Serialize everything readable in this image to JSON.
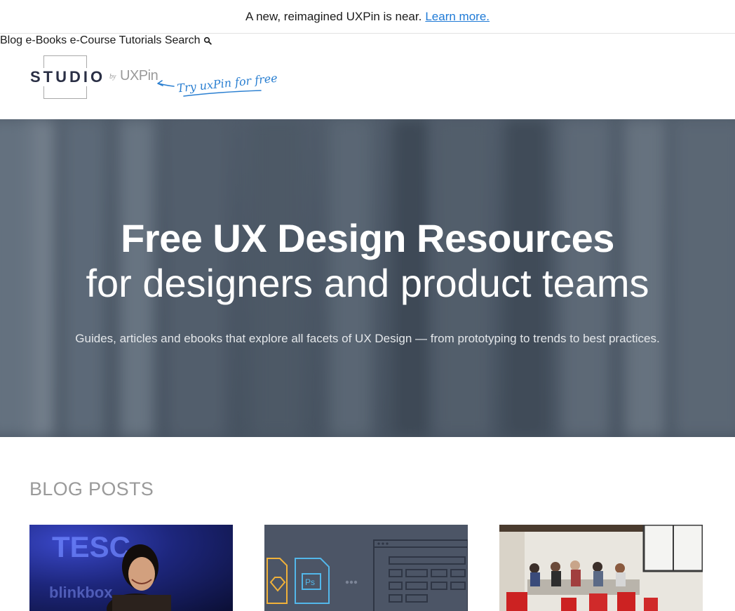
{
  "announcement": {
    "text": "A new, reimagined UXPin is near.",
    "link": "Learn more."
  },
  "header": {
    "logo": {
      "studio": "STUDIO",
      "by": "by",
      "brand": "UXPin"
    },
    "try_free": "Try uxPin for free",
    "nav": [
      {
        "label": "Blog"
      },
      {
        "label": "e-Books"
      },
      {
        "label": "e-Course"
      },
      {
        "label": "Tutorials"
      },
      {
        "label": "Search"
      }
    ]
  },
  "hero": {
    "title": "Free UX Design Resources",
    "subtitle": "for designers and product teams",
    "description": "Guides, articles and ebooks that explore all facets of UX Design — from prototyping to trends to best practices."
  },
  "blog": {
    "section_title": "BLOG POSTS",
    "cards": [
      {
        "thumb_text_1": "TESC",
        "thumb_text_2": "blinkbox"
      },
      {
        "thumb_label": "Ps"
      },
      {}
    ]
  },
  "colors": {
    "link": "#1f7ad6",
    "hero_bg": "#55616f",
    "section_title": "#9a9a9a",
    "logo": "#2a2f45"
  }
}
